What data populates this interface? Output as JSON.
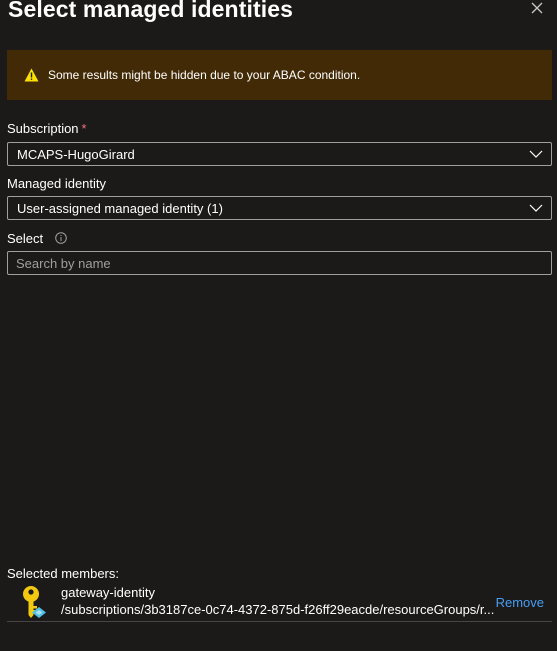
{
  "panel": {
    "title": "Select managed identities"
  },
  "warning": {
    "text": "Some results might be hidden due to your ABAC condition.",
    "icon": "warning-icon"
  },
  "subscription": {
    "label": "Subscription",
    "required_marker": "*",
    "value": "MCAPS-HugoGirard"
  },
  "managed_identity": {
    "label": "Managed identity",
    "value": "User-assigned managed identity (1)"
  },
  "select": {
    "label": "Select",
    "placeholder": "Search by name"
  },
  "selected_members": {
    "label": "Selected members:",
    "items": [
      {
        "name": "gateway-identity",
        "path": "/subscriptions/3b3187ce-0c74-4372-875d-f26ff29eacde/resourceGroups/r...",
        "action": "Remove",
        "icon": "managed-identity-key-icon"
      }
    ]
  },
  "colors": {
    "background": "#1b1a19",
    "warning_bg": "#432a06",
    "warning_icon": "#fce100",
    "link": "#479ef5",
    "border": "#a19f9d",
    "required": "#f1707b"
  }
}
